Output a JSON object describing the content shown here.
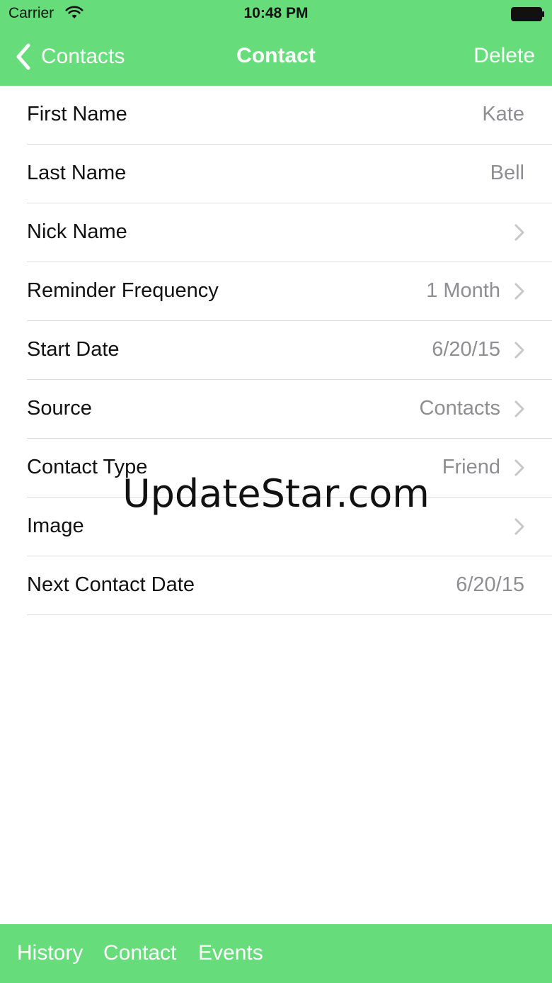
{
  "status_bar": {
    "carrier": "Carrier",
    "time": "10:48 PM",
    "icons": [
      "wifi-icon",
      "battery-icon"
    ]
  },
  "nav": {
    "back_label": "Contacts",
    "title": "Contact",
    "delete_label": "Delete"
  },
  "rows": [
    {
      "label": "First Name",
      "value": "Kate",
      "chevron": false
    },
    {
      "label": "Last Name",
      "value": "Bell",
      "chevron": false
    },
    {
      "label": "Nick Name",
      "value": "",
      "chevron": true
    },
    {
      "label": "Reminder Frequency",
      "value": "1 Month",
      "chevron": true
    },
    {
      "label": "Start Date",
      "value": "6/20/15",
      "chevron": true
    },
    {
      "label": "Source",
      "value": "Contacts",
      "chevron": true
    },
    {
      "label": "Contact Type",
      "value": "Friend",
      "chevron": true
    },
    {
      "label": "Image",
      "value": "",
      "chevron": true
    },
    {
      "label": "Next Contact Date",
      "value": "6/20/15",
      "chevron": false
    }
  ],
  "watermark": "UpdateStar.com",
  "toolbar": {
    "items": [
      "History",
      "Contact",
      "Events"
    ]
  },
  "colors": {
    "accent": "#66dd7a",
    "text": "#111111",
    "secondary_text": "#8e8e93",
    "separator": "#dcdcdc"
  }
}
